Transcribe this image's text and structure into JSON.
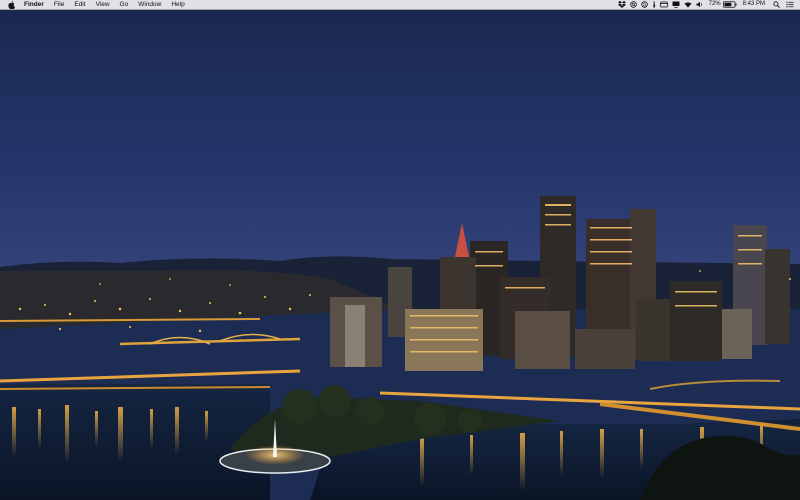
{
  "menubar": {
    "apple_icon": "apple-logo-icon",
    "app_name": "Finder",
    "items": [
      "File",
      "Edit",
      "View",
      "Go",
      "Window",
      "Help"
    ],
    "status": {
      "icons": [
        "dropbox-icon",
        "search-circle-icon",
        "sync-icon",
        "info-icon",
        "tabs-icon",
        "display-icon",
        "wifi-icon",
        "volume-icon"
      ],
      "battery_percent": "72%",
      "battery_level": 0.72,
      "time": "8:43 PM",
      "right_icons": [
        "spotlight-icon",
        "notification-center-icon"
      ]
    },
    "colors": {
      "bar": "#e8e8ec",
      "text": "#111111"
    }
  },
  "desktop": {
    "wallpaper": "night-city-skyline",
    "colors": {
      "sky_top": "#1b2a50",
      "sky_horizon": "#2f4070",
      "river": "#0d1a2e",
      "lights": "#f5b445"
    }
  }
}
